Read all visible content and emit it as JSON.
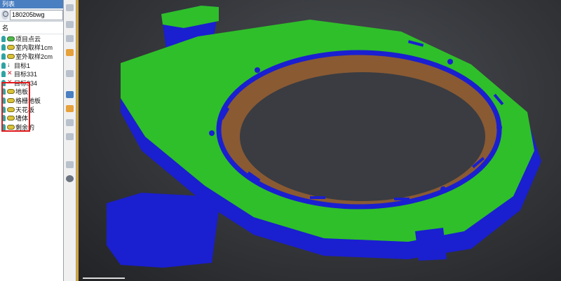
{
  "panel": {
    "title": "列表",
    "search_value": "180205bwg",
    "column_header": "名",
    "items": [
      {
        "label": "项目点云",
        "icon": "point-cloud-green"
      },
      {
        "label": "室内取样1cm",
        "icon": "point-cloud"
      },
      {
        "label": "室外取样2cm",
        "icon": "point-cloud"
      },
      {
        "label": "目标1",
        "icon": "target"
      },
      {
        "label": "目标331",
        "icon": "target"
      },
      {
        "label": "目标334",
        "icon": "target"
      },
      {
        "label": "地板",
        "icon": "point-cloud"
      },
      {
        "label": "格栅地板",
        "icon": "point-cloud"
      },
      {
        "label": "天花板",
        "icon": "point-cloud"
      },
      {
        "label": "墙体",
        "icon": "point-cloud"
      },
      {
        "label": "剩余的",
        "icon": "point-cloud"
      }
    ]
  },
  "colors": {
    "panel_title_bg": "#4a7fc1",
    "highlight_box": "#e0191b",
    "splitter": "#d9a531",
    "scan_top": "#2fbf2a",
    "scan_wall": "#1a1fd0",
    "scan_inner": "#8a5a33"
  }
}
